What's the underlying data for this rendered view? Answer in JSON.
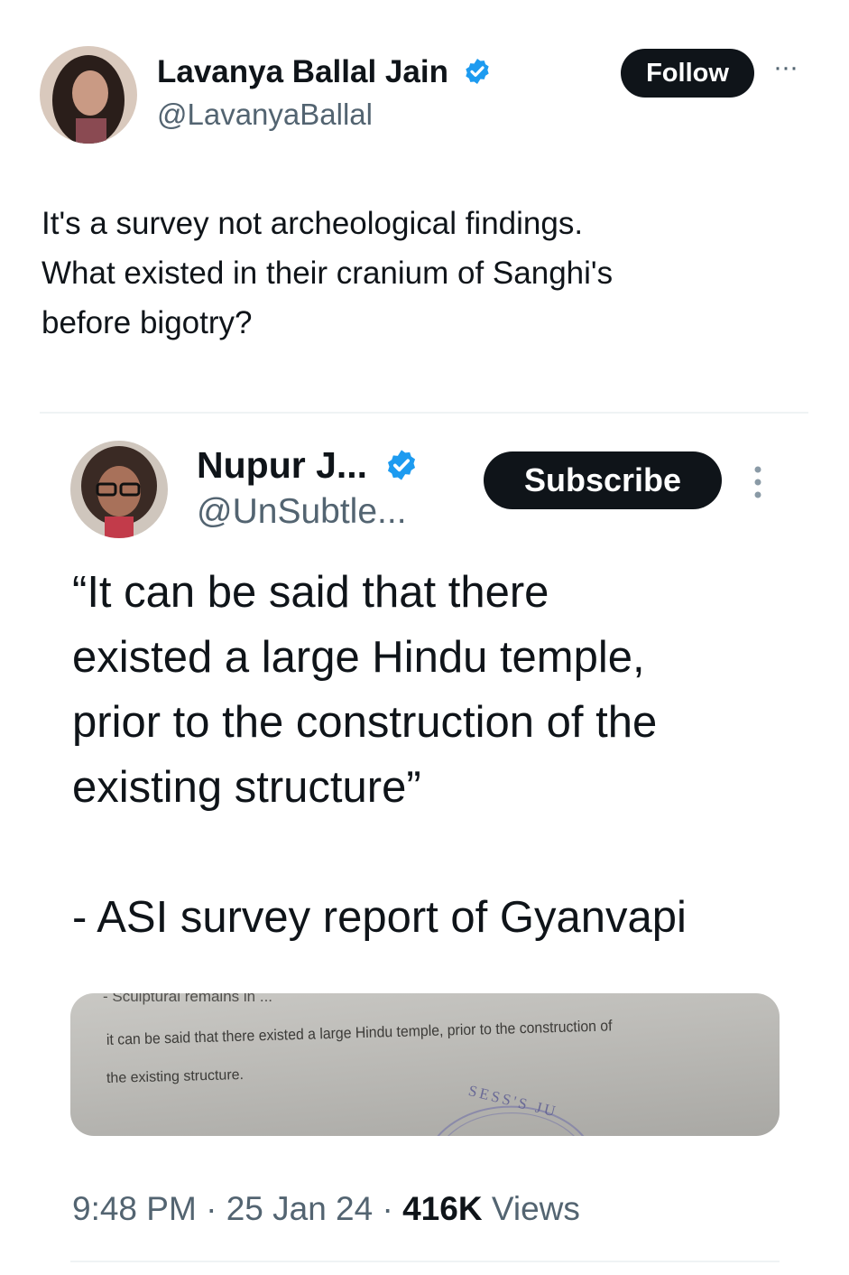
{
  "main_tweet": {
    "author_name": "Lavanya Ballal Jain",
    "author_handle": "@LavanyaBallal",
    "follow_label": "Follow",
    "more_label": "···",
    "body": "It's a survey not archeological findings.\nWhat existed in their cranium of Sanghi's\nbefore bigotry?"
  },
  "quoted_tweet": {
    "author_name": "Nupur J...",
    "author_handle": "@UnSubtle...",
    "subscribe_label": "Subscribe",
    "quote": "“It can be said that there\nexisted a large Hindu temple,\nprior to the construction of the\nexisting structure”",
    "attribution": "- ASI survey report of Gyanvapi",
    "document": {
      "line_top": "- Sculptural remains in ...",
      "line_main": "it can be said that there existed a large Hindu temple, prior to the construction of",
      "line_end": "the existing structure.",
      "stamp_text": "SESS'S JU"
    },
    "time": "9:48 PM",
    "date": "25 Jan 24",
    "views_count": "416K",
    "views_label": "Views",
    "separator": "·"
  },
  "colors": {
    "text": "#0f1419",
    "secondary": "#536471",
    "verified": "#1d9bf0",
    "button": "#0f1419"
  }
}
